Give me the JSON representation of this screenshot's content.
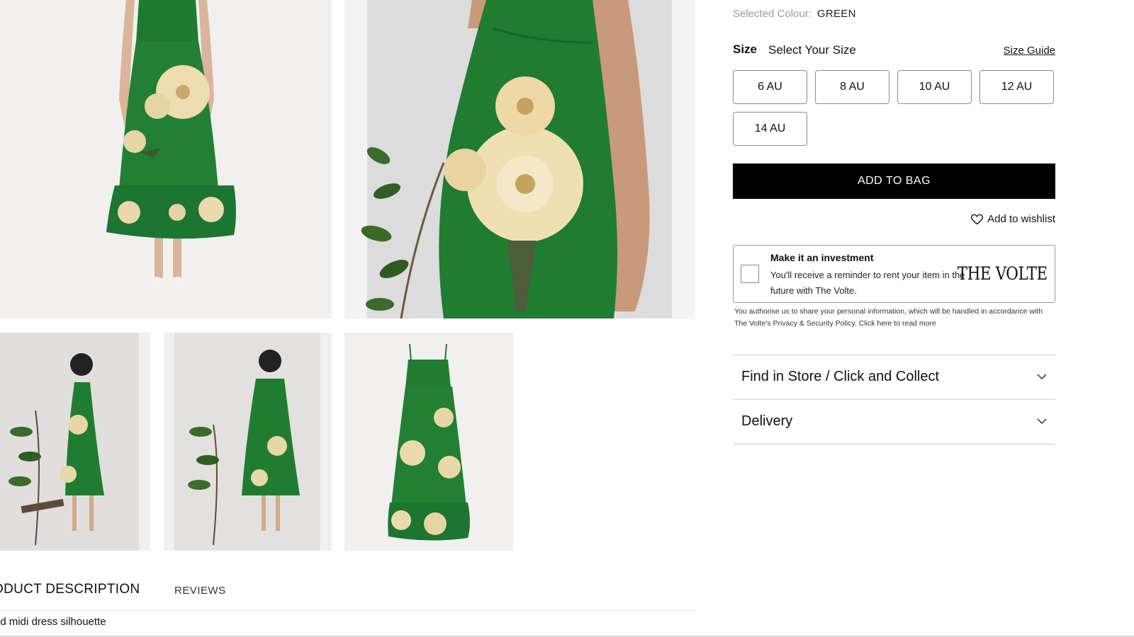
{
  "gallery": {
    "images": [
      {
        "alt": "front-dress-image"
      },
      {
        "alt": "detail-dress-image"
      },
      {
        "alt": "side-dress-image"
      },
      {
        "alt": "back-dress-image"
      },
      {
        "alt": "flat-dress-image"
      }
    ]
  },
  "tabs": {
    "description_label": "ODUCT DESCRIPTION",
    "reviews_label": "REVIEWS",
    "description_text": "ed midi dress silhouette"
  },
  "product": {
    "colour_label": "Selected Colour:",
    "colour_value": "GREEN",
    "size_label": "Size",
    "size_prompt": "Select Your Size",
    "size_guide": "Size Guide",
    "sizes": [
      "6 AU",
      "8 AU",
      "10 AU",
      "12 AU",
      "14 AU"
    ],
    "add_to_bag": "ADD TO BAG",
    "wishlist": "Add to wishlist"
  },
  "investment": {
    "title": "Make it an investment",
    "text": "You'll receive a reminder to rent your item in the future with The Volte.",
    "logo": "THE VOLTE",
    "consent": "You authorise us to share your personal information, which will be handled in accordance with The Volte's Privacy & Security Policy. Click here to read more"
  },
  "accordions": [
    {
      "label": "Find in Store / Click and Collect"
    },
    {
      "label": "Delivery"
    }
  ],
  "icons": {
    "wishlist": "heart-icon",
    "accordion": "chevron-down-icon"
  },
  "colors": {
    "dress_green": "#1f7a30",
    "flower_cream": "#efe1b8",
    "button_black": "#000000"
  }
}
